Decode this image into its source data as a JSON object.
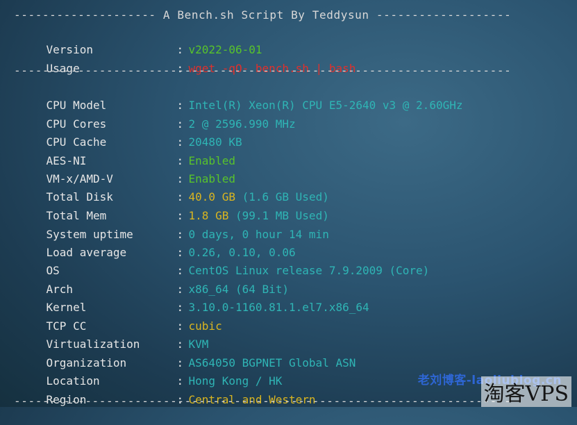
{
  "header": {
    "divider_title": "-------------------- A Bench.sh Script By Teddysun -------------------"
  },
  "divider": "----------------------------------------------------------------------",
  "colon": ":",
  "rows_top": [
    {
      "label": "Version",
      "value": "v2022-06-01",
      "color": "green"
    },
    {
      "label": "Usage",
      "value": "wget -qO- bench.sh | bash",
      "color": "red"
    }
  ],
  "rows_main": [
    {
      "label": "CPU Model",
      "value": "Intel(R) Xeon(R) CPU E5-2640 v3 @ 2.60GHz",
      "extra": ""
    },
    {
      "label": "CPU Cores",
      "value": "2 @ 2596.990 MHz",
      "extra": ""
    },
    {
      "label": "CPU Cache",
      "value": "20480 KB",
      "extra": ""
    },
    {
      "label": "AES-NI",
      "value": "Enabled",
      "extra": ""
    },
    {
      "label": "VM-x/AMD-V",
      "value": "Enabled",
      "extra": ""
    },
    {
      "label": "Total Disk",
      "value": "40.0 GB",
      "extra": "(1.6 GB Used)"
    },
    {
      "label": "Total Mem",
      "value": "1.8 GB",
      "extra": "(99.1 MB Used)"
    },
    {
      "label": "System uptime",
      "value": "0 days, 0 hour 14 min",
      "extra": ""
    },
    {
      "label": "Load average",
      "value": "0.26, 0.10, 0.06",
      "extra": ""
    },
    {
      "label": "OS",
      "value": "CentOS Linux release 7.9.2009 (Core)",
      "extra": ""
    },
    {
      "label": "Arch",
      "value": "x86_64 (64 Bit)",
      "extra": ""
    },
    {
      "label": "Kernel",
      "value": "3.10.0-1160.81.1.el7.x86_64",
      "extra": ""
    },
    {
      "label": "TCP CC",
      "value": "cubic",
      "extra": ""
    },
    {
      "label": "Virtualization",
      "value": "KVM",
      "extra": ""
    },
    {
      "label": "Organization",
      "value": "AS64050 BGPNET Global ASN",
      "extra": ""
    },
    {
      "label": "Location",
      "value": "Hong Kong / HK",
      "extra": ""
    },
    {
      "label": "Region",
      "value": "Central and Western",
      "extra": ""
    }
  ],
  "watermarks": {
    "blog": "老刘博客-laoliublog.cn",
    "site": "淘客VPS"
  },
  "colors": {
    "green": "#58c32b",
    "red": "#e0302c",
    "cyan": "#2fb5b5",
    "yellow": "#d9b520"
  }
}
